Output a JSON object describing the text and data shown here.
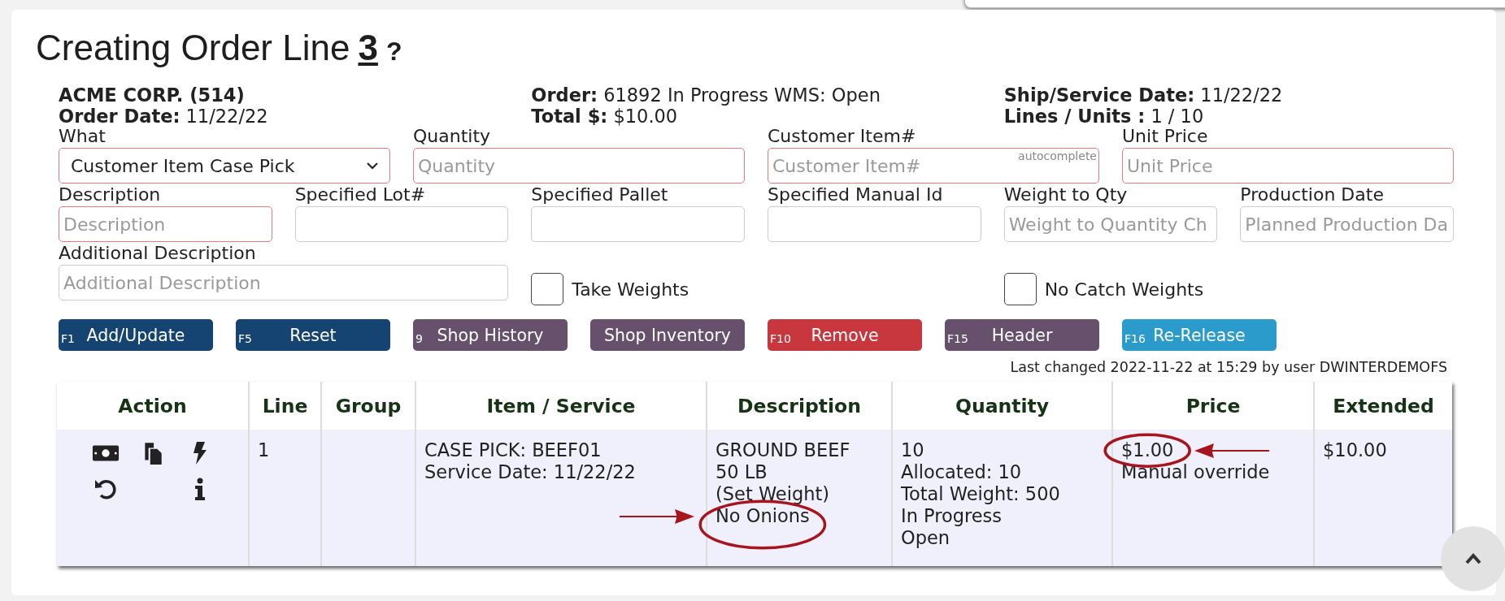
{
  "page_title": {
    "text": "Creating Order Line",
    "line_number": "3",
    "help": "?"
  },
  "order_summary": [
    [
      {
        "label": "ACME CORP. (514)"
      },
      {
        "label": "Order Date:",
        "value": "11/22/22"
      }
    ],
    [
      {
        "label": "Order:",
        "value": "61892 In Progress WMS: Open"
      },
      {
        "label": "Total $:",
        "value": "$10.00"
      }
    ],
    [
      {
        "label": "Ship/Service Date:",
        "value": "11/22/22"
      },
      {
        "label": "Lines / Units :",
        "value": "1 / 10"
      }
    ]
  ],
  "form_rows": [
    [
      {
        "kind": "select",
        "label": "What",
        "value": "Customer Item Case Pick",
        "required": true
      },
      {
        "kind": "input",
        "label": "Quantity",
        "placeholder": "Quantity",
        "required": true
      },
      {
        "kind": "input",
        "label": "Customer Item#",
        "placeholder": "Customer Item#",
        "hint": "autocomplete",
        "required": true
      },
      {
        "kind": "input",
        "label": "Unit Price",
        "placeholder": "Unit Price",
        "required": true
      }
    ],
    [
      {
        "kind": "input",
        "label": "Description",
        "placeholder": "Description",
        "required": true
      },
      {
        "kind": "input",
        "label": "Specified Lot#",
        "required": false
      },
      {
        "kind": "input",
        "label": "Specified Pallet",
        "required": false
      },
      {
        "kind": "input",
        "label": "Specified Manual Id",
        "required": false
      },
      {
        "kind": "input",
        "label": "Weight to Qty",
        "placeholder": "Weight to Quantity Ch",
        "required": false
      },
      {
        "kind": "input",
        "label": "Production Date",
        "placeholder": "Planned Production Da",
        "required": false
      }
    ],
    [
      {
        "kind": "input",
        "label": "Additional Description",
        "placeholder": "Additional Description",
        "required": false
      },
      {
        "kind": "checkbox",
        "label": "Take Weights",
        "checked": false
      },
      {
        "kind": "checkbox",
        "label": "No Catch Weights",
        "checked": false
      }
    ]
  ],
  "buttons": [
    {
      "key": "F1",
      "label": "Add/Update",
      "color": "#154473"
    },
    {
      "key": "F5",
      "label": "Reset",
      "color": "#154473"
    },
    {
      "key": "9",
      "label": "Shop History",
      "color": "#67506b"
    },
    {
      "label": "Shop Inventory",
      "color": "#67506b"
    },
    {
      "key": "F10",
      "label": "Remove",
      "color": "#c8363e"
    },
    {
      "key": "F15",
      "label": "Header",
      "color": "#67506b"
    },
    {
      "key": "F16",
      "label": "Re-Release",
      "color": "#2b9bcc"
    }
  ],
  "last_changed": "Last changed 2022-11-22 at 15:29 by user DWINTERDEMOFS",
  "order_lines": {
    "columns": [
      "Action",
      "Line",
      "Group",
      "Item / Service",
      "Description",
      "Quantity",
      "Price",
      "Extended"
    ],
    "rows": [
      {
        "line": "1",
        "item_service": [
          "CASE PICK: BEEF01",
          "Service Date: 11/22/22"
        ],
        "description": [
          {
            "text": "GROUND BEEF",
            "kind": "plain"
          },
          {
            "text": "50 LB",
            "kind": "plain"
          },
          {
            "text": "(Set Weight)",
            "kind": "plain"
          },
          {
            "text": "No Onions",
            "kind": "callout-from-left"
          }
        ],
        "quantity": [
          "10",
          "Allocated: 10",
          "Total Weight: 500",
          "In Progress",
          "Open"
        ],
        "price": [
          {
            "text": "$1.00",
            "kind": "callout-from-right"
          },
          {
            "text": "Manual override",
            "kind": "plain"
          }
        ],
        "extended": [
          "$10.00"
        ]
      }
    ]
  }
}
